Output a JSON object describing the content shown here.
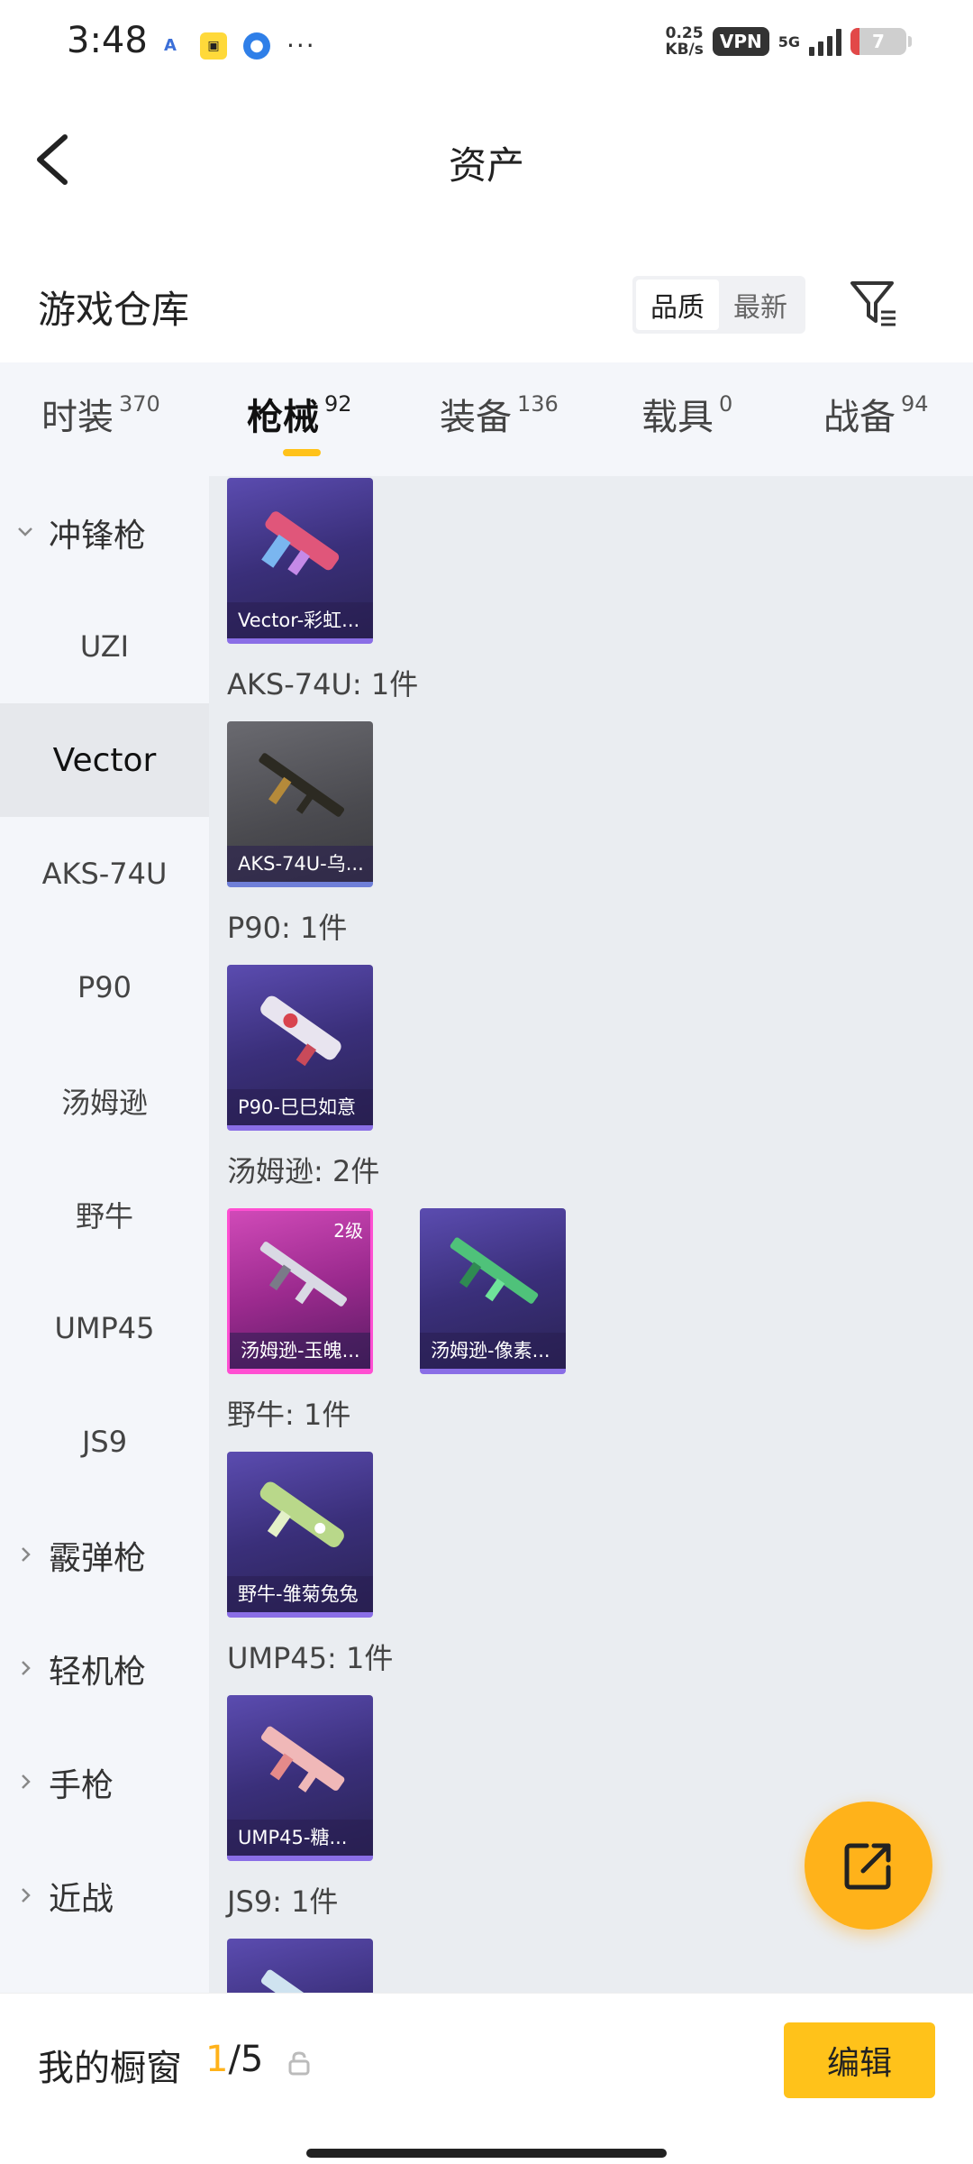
{
  "status_bar": {
    "time": "3:48",
    "speed_value": "0.25",
    "speed_unit": "KB/s",
    "vpn": "VPN",
    "network": "5G",
    "battery": "7"
  },
  "header": {
    "title": "资产"
  },
  "warehouse": {
    "title": "游戏仓库",
    "sort_options": [
      "品质",
      "最新"
    ],
    "active_sort": "品质"
  },
  "tabs": [
    {
      "label": "时装",
      "count": "370"
    },
    {
      "label": "枪械",
      "count": "92"
    },
    {
      "label": "装备",
      "count": "136"
    },
    {
      "label": "载具",
      "count": "0"
    },
    {
      "label": "战备",
      "count": "94"
    }
  ],
  "active_tab": "枪械",
  "sidebar": {
    "items": [
      {
        "label": "冲锋枪",
        "type": "group",
        "expanded": true
      },
      {
        "label": "UZI",
        "type": "sub"
      },
      {
        "label": "Vector",
        "type": "sub",
        "selected": true
      },
      {
        "label": "AKS-74U",
        "type": "sub"
      },
      {
        "label": "P90",
        "type": "sub"
      },
      {
        "label": "汤姆逊",
        "type": "sub"
      },
      {
        "label": "野牛",
        "type": "sub"
      },
      {
        "label": "UMP45",
        "type": "sub"
      },
      {
        "label": "JS9",
        "type": "sub"
      },
      {
        "label": "霰弹枪",
        "type": "group"
      },
      {
        "label": "轻机枪",
        "type": "group"
      },
      {
        "label": "手枪",
        "type": "group"
      },
      {
        "label": "近战",
        "type": "group"
      }
    ]
  },
  "groups": [
    {
      "label": "",
      "items": [
        {
          "name": "Vector-彩虹...",
          "level": ""
        }
      ]
    },
    {
      "label": "AKS-74U: 1件",
      "items": [
        {
          "name": "AKS-74U-乌...",
          "level": ""
        }
      ]
    },
    {
      "label": "P90: 1件",
      "items": [
        {
          "name": "P90-巳巳如意",
          "level": ""
        }
      ]
    },
    {
      "label": "汤姆逊: 2件",
      "items": [
        {
          "name": "汤姆逊-玉魄...",
          "level": "2级"
        },
        {
          "name": "汤姆逊-像素...",
          "level": ""
        }
      ]
    },
    {
      "label": "野牛: 1件",
      "items": [
        {
          "name": "野牛-雏菊兔兔",
          "level": ""
        }
      ]
    },
    {
      "label": "UMP45: 1件",
      "items": [
        {
          "name": "UMP45-糖...",
          "level": ""
        }
      ]
    },
    {
      "label": "JS9: 1件",
      "items": []
    }
  ],
  "bottom_bar": {
    "label": "我的橱窗",
    "current": "1",
    "total": "/5",
    "edit_label": "编辑"
  },
  "colors": {
    "accent": "#ffc21a",
    "fab": "#ffb21a",
    "sidebar_bg": "#f4f6fa",
    "content_bg": "#eaedf1"
  }
}
